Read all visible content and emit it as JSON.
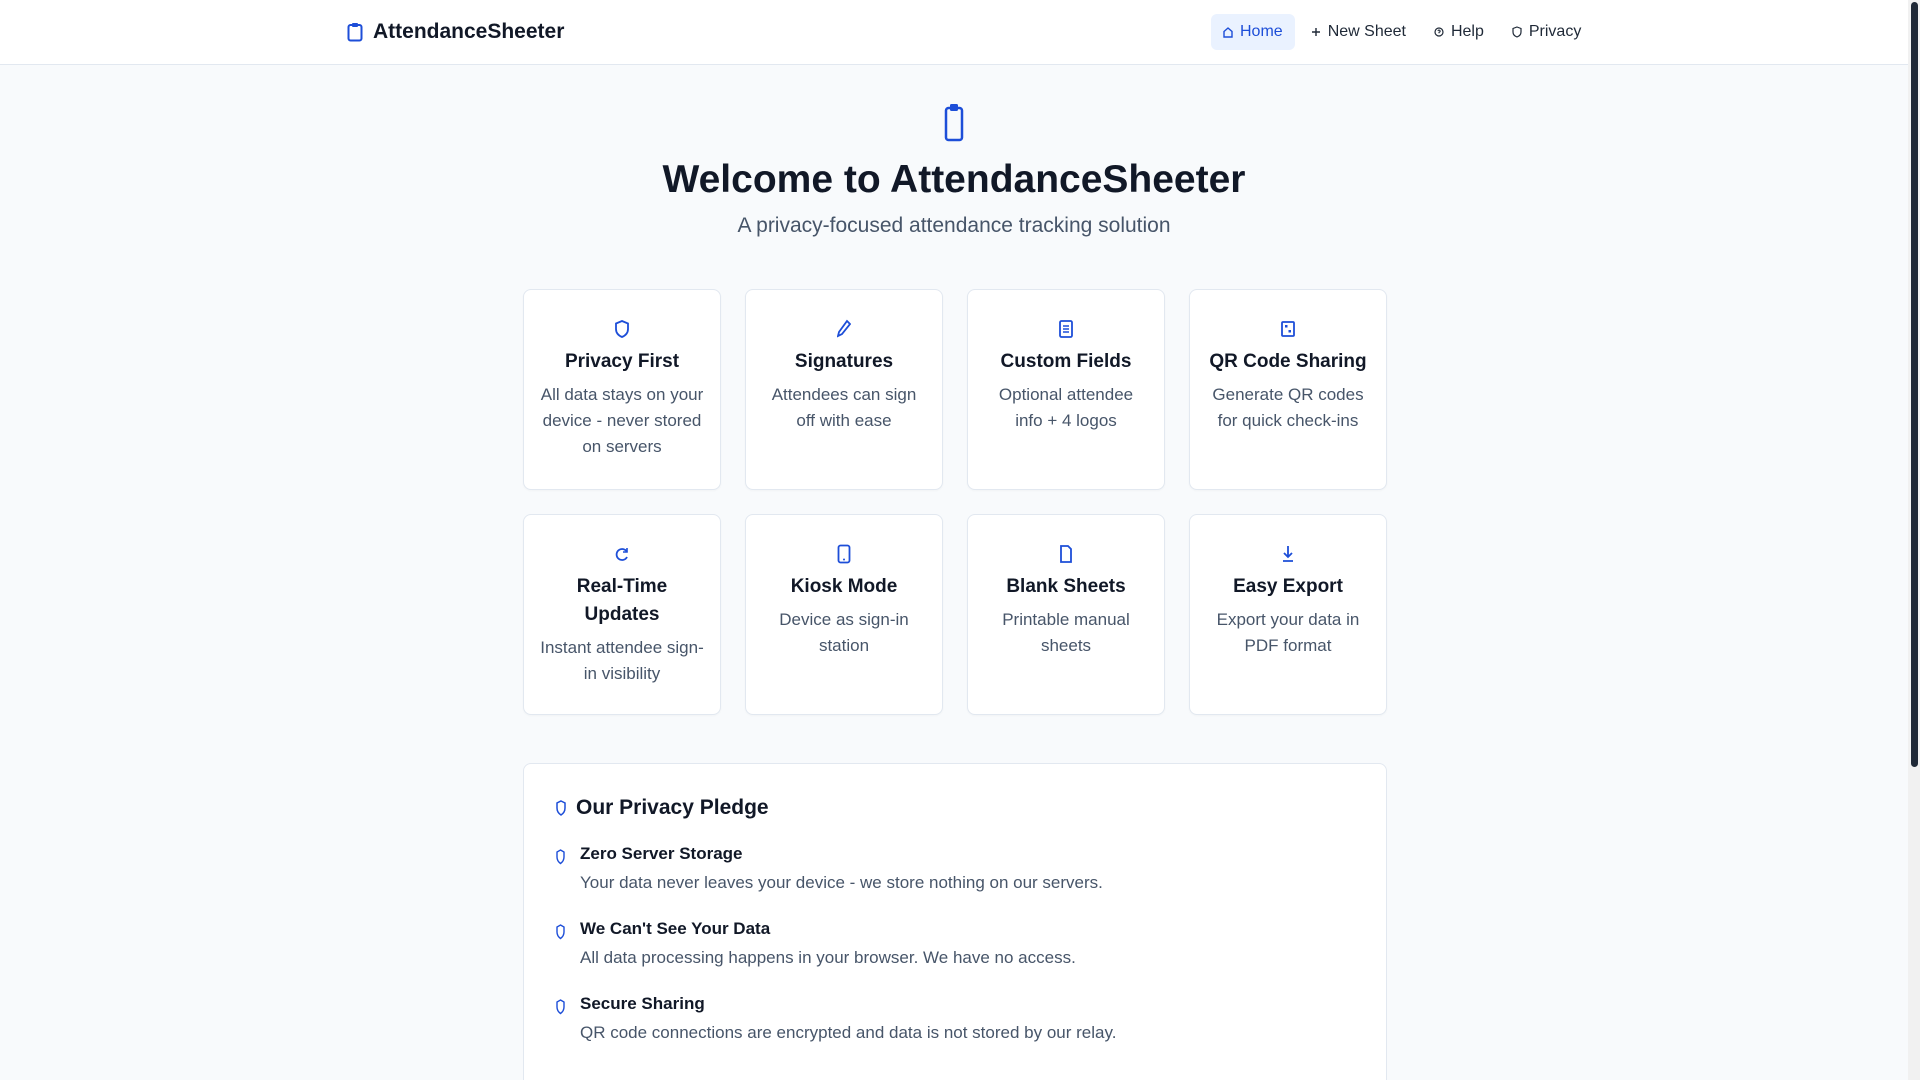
{
  "colors": {
    "accent": "#1d4ed8",
    "accent_soft": "#eaf2ff",
    "text": "#111827",
    "muted": "#475569",
    "border": "#e2e8f0",
    "background": "#f8fafc"
  },
  "navbar": {
    "brand": {
      "icon": "clipboard-icon",
      "label": "AttendanceSheeter"
    },
    "links": [
      {
        "icon": "home-icon",
        "label": "Home",
        "active": true
      },
      {
        "icon": "plus-icon",
        "label": "New Sheet",
        "active": false
      },
      {
        "icon": "question-icon",
        "label": "Help",
        "active": false
      },
      {
        "icon": "shield-icon",
        "label": "Privacy",
        "active": false
      }
    ]
  },
  "hero": {
    "icon": "clipboard-icon",
    "title": "Welcome to AttendanceSheeter",
    "subtitle": "A privacy-focused attendance tracking solution"
  },
  "features": [
    {
      "icon": "shield-icon",
      "title": "Privacy First",
      "desc": "All data stays on your device - never stored on servers"
    },
    {
      "icon": "pen-icon",
      "title": "Signatures",
      "desc": "Attendees can sign off with ease"
    },
    {
      "icon": "list-icon",
      "title": "Custom Fields",
      "desc": "Optional attendee info + 4 logos"
    },
    {
      "icon": "qr-code-icon",
      "title": "QR Code Sharing",
      "desc": "Generate QR codes for quick check-ins"
    },
    {
      "icon": "refresh-icon",
      "title": "Real-Time Updates",
      "desc": "Instant attendee sign-in visibility"
    },
    {
      "icon": "tablet-icon",
      "title": "Kiosk Mode",
      "desc": "Device as sign-in station"
    },
    {
      "icon": "document-icon",
      "title": "Blank Sheets",
      "desc": "Printable manual sheets"
    },
    {
      "icon": "download-icon",
      "title": "Easy Export",
      "desc": "Export your data in PDF format"
    }
  ],
  "pledge": {
    "icon": "shield-icon",
    "title": "Our Privacy Pledge",
    "items": [
      {
        "icon": "shield-check-icon",
        "title": "Zero Server Storage",
        "text": "Your data never leaves your device - we store nothing on our servers."
      },
      {
        "icon": "shield-check-icon",
        "title": "We Can't See Your Data",
        "text": "All data processing happens in your browser. We have no access."
      },
      {
        "icon": "shield-check-icon",
        "title": "Secure Sharing",
        "text": "QR code connections are encrypted and data is not stored by our relay."
      }
    ]
  }
}
